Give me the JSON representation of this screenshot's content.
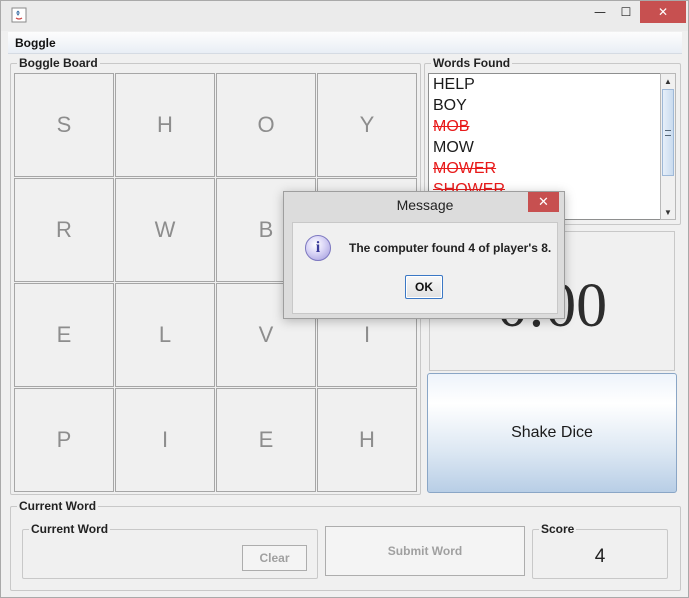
{
  "window": {
    "controls": {
      "minimize": "—",
      "maximize": "☐",
      "close": "✕"
    }
  },
  "menubar": {
    "items": [
      "Boggle"
    ]
  },
  "board": {
    "legend": "Boggle Board",
    "dice": [
      "S",
      "H",
      "O",
      "Y",
      "R",
      "W",
      "B",
      "",
      "E",
      "L",
      "V",
      "I",
      "P",
      "I",
      "E",
      "H"
    ]
  },
  "words_found": {
    "legend": "Words Found",
    "items": [
      {
        "text": "HELP",
        "struck": false
      },
      {
        "text": "BOY",
        "struck": false
      },
      {
        "text": "MOB",
        "struck": true
      },
      {
        "text": "MOW",
        "struck": false
      },
      {
        "text": "MOWER",
        "struck": true
      },
      {
        "text": "SHOWER",
        "struck": true
      }
    ]
  },
  "timer": {
    "value": "0:00"
  },
  "shake_button": {
    "label": "Shake Dice"
  },
  "current_word_panel": {
    "legend": "Current Word",
    "inner_legend": "Current Word",
    "clear_label": "Clear",
    "submit_label": "Submit Word",
    "score_legend": "Score",
    "score_value": "4"
  },
  "dialog": {
    "title": "Message",
    "close": "✕",
    "message": "The computer found 4 of player's 8.",
    "ok_label": "OK",
    "icon": "info-icon"
  },
  "colors": {
    "struck_word": "#e81a1a",
    "dialog_close": "#c75050",
    "shake_button_gradient_end": "#b8cee6"
  }
}
